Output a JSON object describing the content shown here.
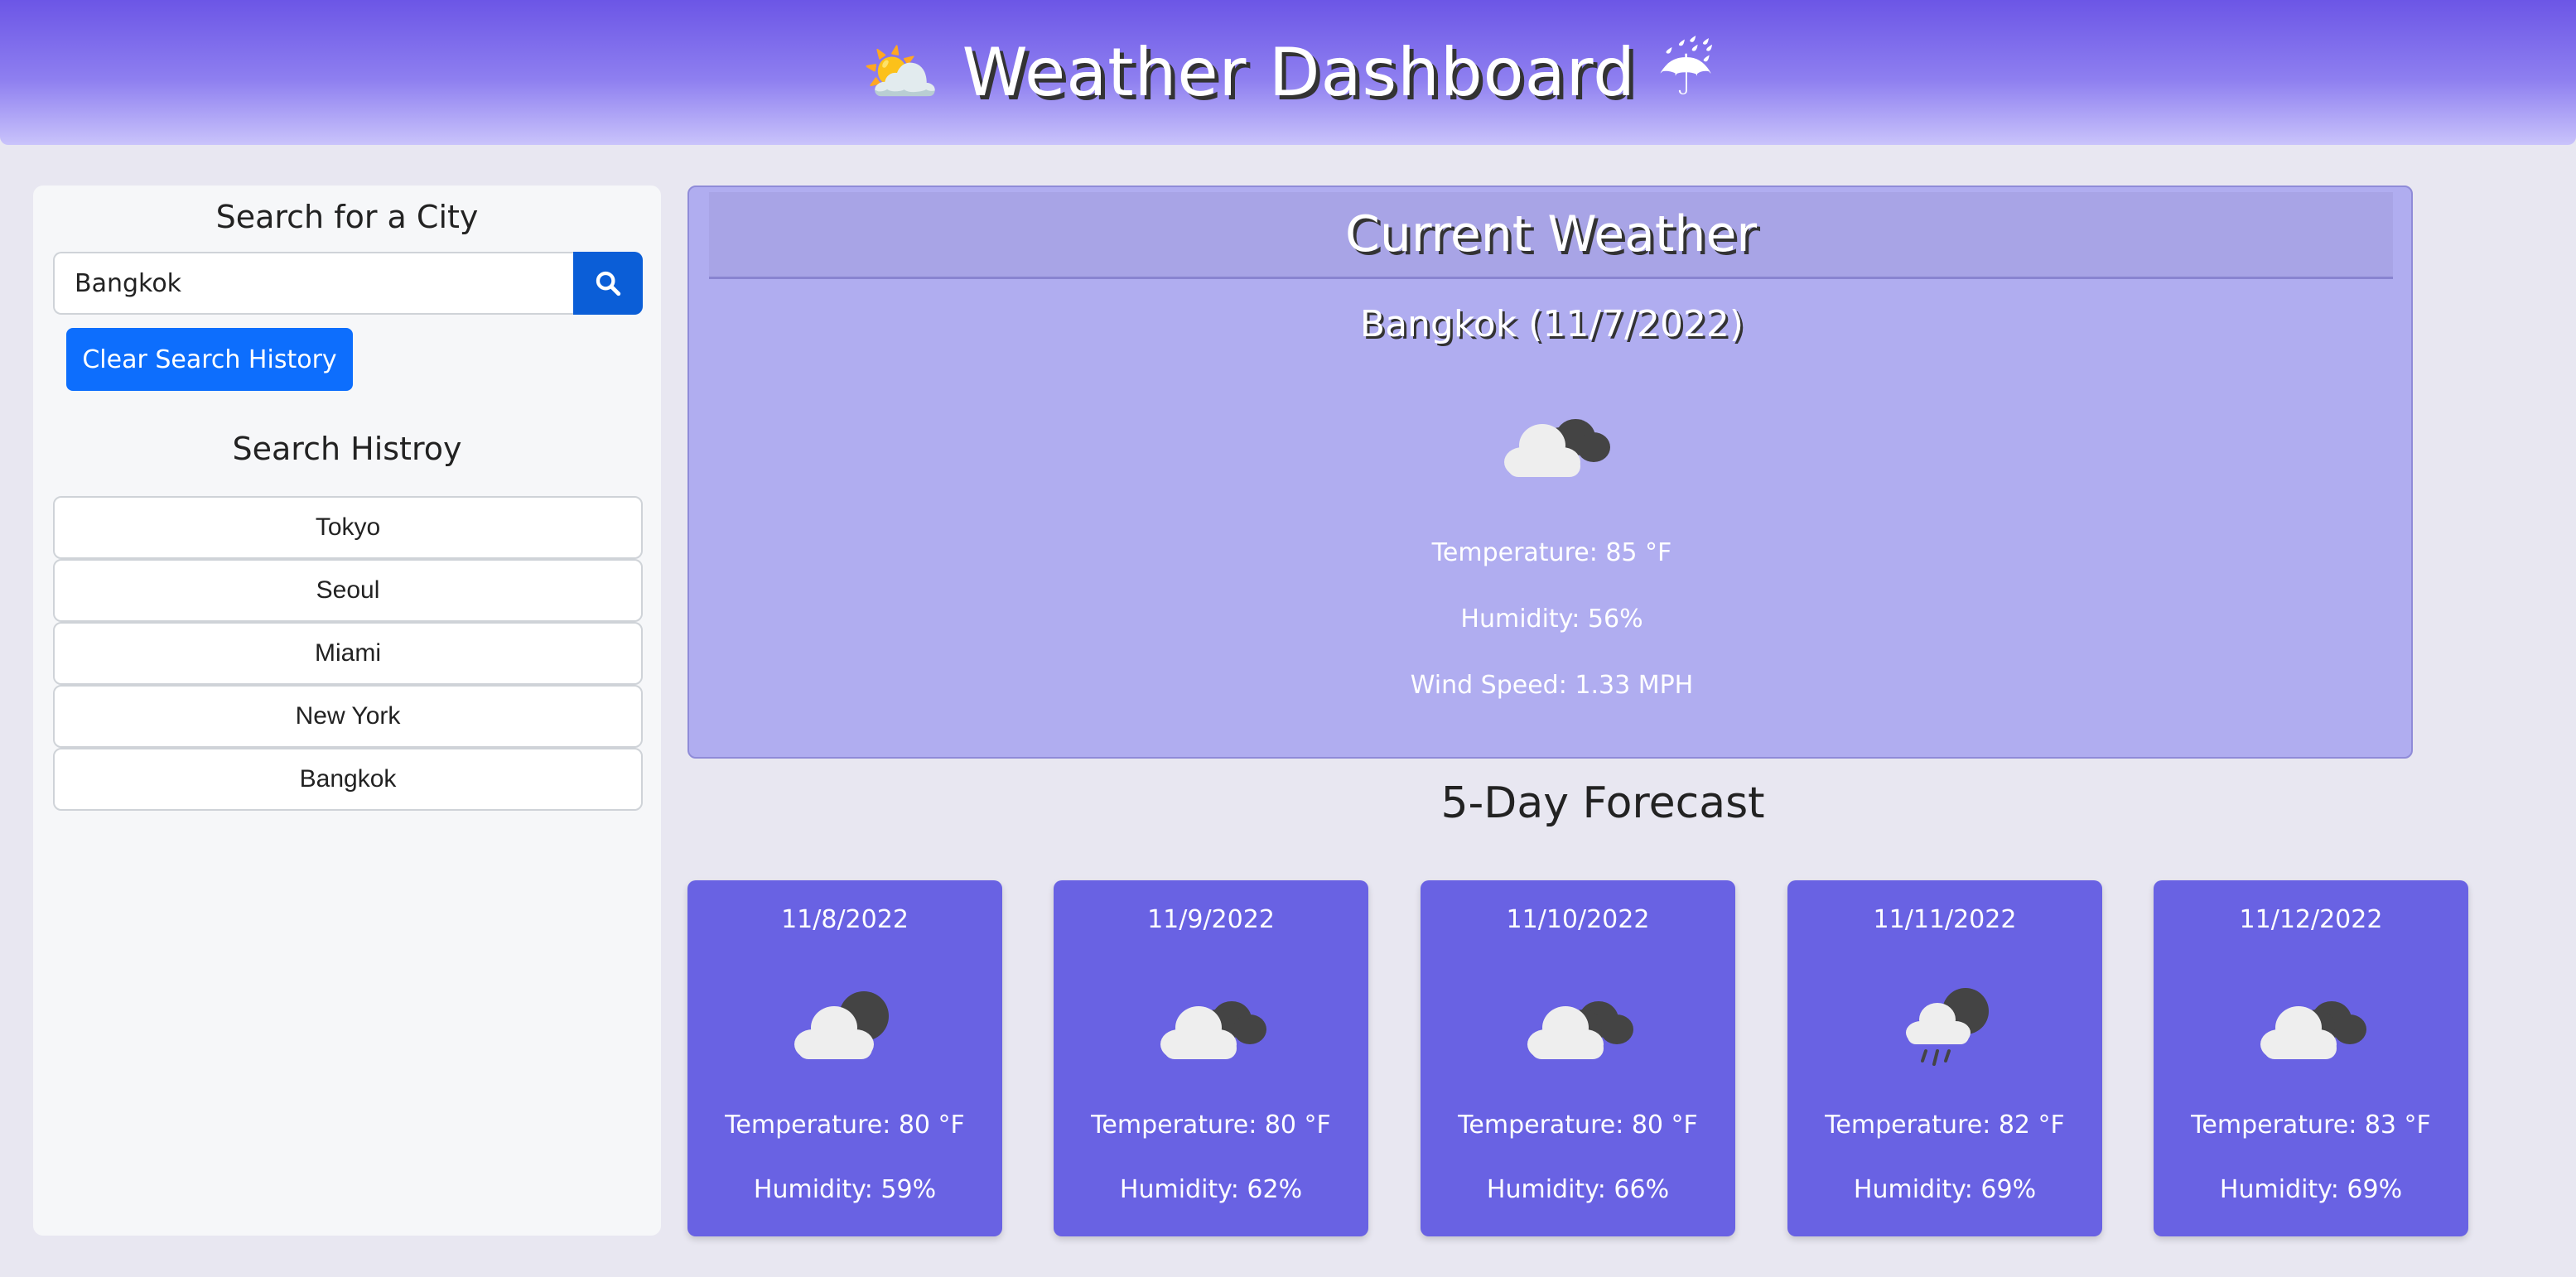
{
  "header": {
    "title": "Weather Dashboard",
    "left_emoji": "⛅",
    "right_emoji": "☔"
  },
  "sidebar": {
    "search_title": "Search for a City",
    "search_value": "Bangkok",
    "search_icon": "search-icon",
    "clear_label": "Clear Search History",
    "history_title": "Search Histroy",
    "history": [
      "Tokyo",
      "Seoul",
      "Miami",
      "New York",
      "Bangkok"
    ]
  },
  "current": {
    "heading": "Current Weather",
    "city_date": "Bangkok (11/7/2022)",
    "icon": "broken-clouds-icon",
    "temperature": "Temperature: 85 °F",
    "humidity": "Humidity: 56%",
    "wind": "Wind Speed: 1.33 MPH"
  },
  "forecast": {
    "title": "5-Day Forecast",
    "days": [
      {
        "date": "11/8/2022",
        "icon": "partly-cloudy-icon",
        "temp": "Temperature: 80 °F",
        "humidity": "Humidity: 59%"
      },
      {
        "date": "11/9/2022",
        "icon": "broken-clouds-icon",
        "temp": "Temperature: 80 °F",
        "humidity": "Humidity: 62%"
      },
      {
        "date": "11/10/2022",
        "icon": "broken-clouds-icon",
        "temp": "Temperature: 80 °F",
        "humidity": "Humidity: 66%"
      },
      {
        "date": "11/11/2022",
        "icon": "rain-icon",
        "temp": "Temperature: 82 °F",
        "humidity": "Humidity: 69%"
      },
      {
        "date": "11/12/2022",
        "icon": "broken-clouds-icon",
        "temp": "Temperature: 83 °F",
        "humidity": "Humidity: 69%"
      }
    ]
  },
  "colors": {
    "header_start": "#6c56e6",
    "current_bg": "#b0adf0",
    "card_bg": "#6962e3",
    "button_blue": "#0d6efd"
  }
}
